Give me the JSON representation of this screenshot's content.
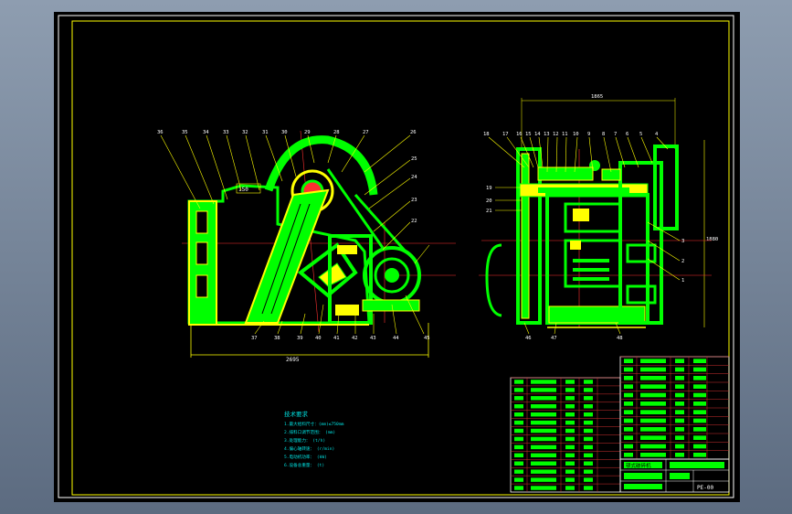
{
  "drawing": {
    "callouts_left_top": [
      "36",
      "35",
      "34",
      "33",
      "32",
      "31",
      "30",
      "29",
      "28",
      "27",
      "26"
    ],
    "callouts_left_right": [
      "25",
      "24",
      "23",
      "22"
    ],
    "callouts_left_bottom": [
      "37",
      "38",
      "39",
      "40",
      "41",
      "42",
      "43",
      "44",
      "45"
    ],
    "callouts_right_top": [
      "18",
      "17",
      "16",
      "15",
      "14",
      "13",
      "12",
      "11",
      "10",
      "9",
      "8",
      "7",
      "6",
      "5",
      "4"
    ],
    "callouts_right_left": [
      "19",
      "20",
      "21"
    ],
    "callouts_right_right": [
      "3",
      "2",
      "1"
    ],
    "callouts_right_bottom": [
      "46",
      "47",
      "48"
    ],
    "dim_left_width": "2695",
    "dim_right_top": "1865",
    "dim_right_height": "1880",
    "small_label_150": "150"
  },
  "tech_notes": {
    "title": "技术要求",
    "lines": [
      "1.最大给料尺寸：(mm)≤750mm",
      "2.排料口调节范围：    (mm)",
      "3.处理能力：     (t/h)",
      "4.偏心轴转速：   (r/min)",
      "5.电动机功率：  (kW)",
      "6.设备总重量：  (t)"
    ]
  },
  "title_block": {
    "drawing_no": "PE-00",
    "name": "颚式破碎机"
  },
  "colors": {
    "frame": "#ffff00",
    "part": "#00ff00",
    "accent_red": "#ff3030",
    "note_cyan": "#00e0e0",
    "white": "#ffffff",
    "table_red": "#d03030"
  }
}
